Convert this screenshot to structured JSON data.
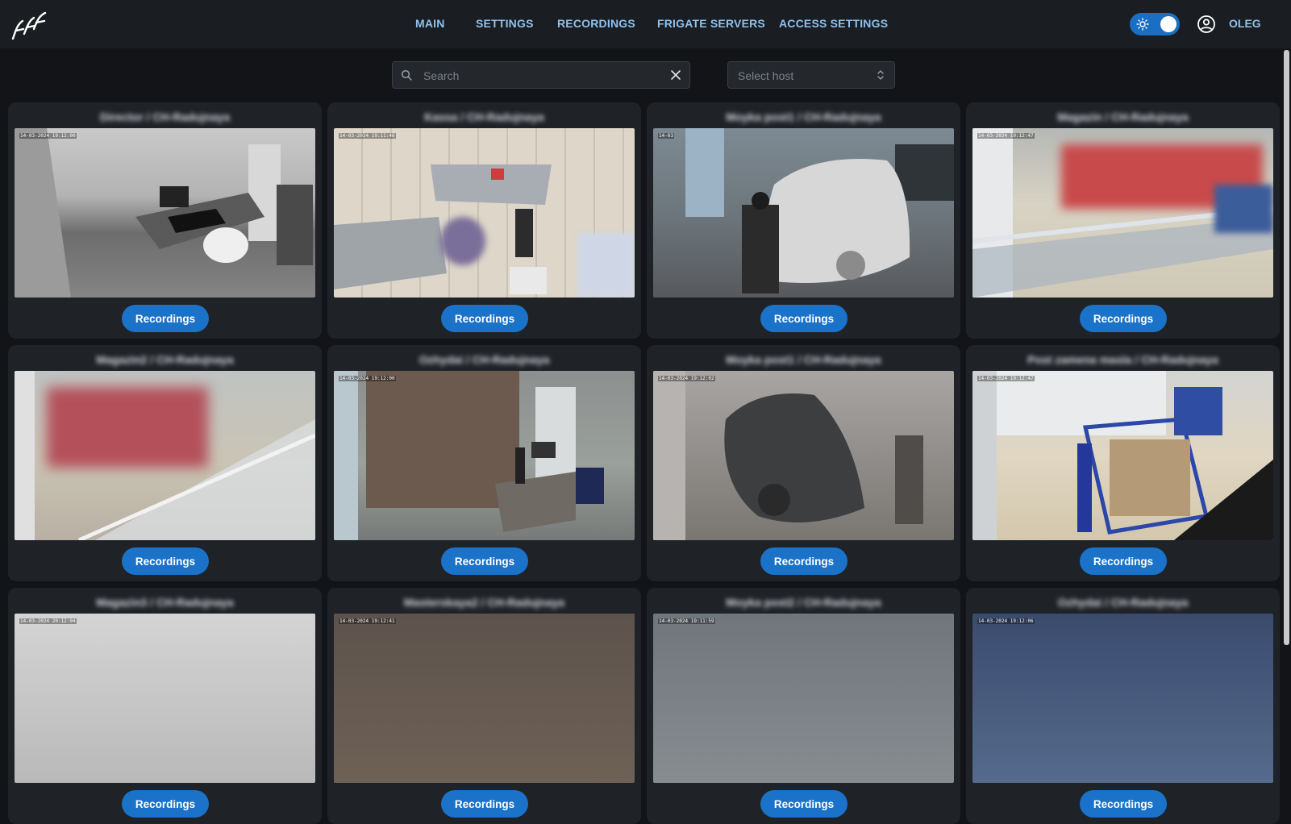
{
  "header": {
    "nav": [
      "MAIN",
      "SETTINGS",
      "RECORDINGS",
      "FRIGATE SERVERS",
      "ACCESS SETTINGS"
    ],
    "user_name": "OLEG",
    "theme_toggle": "light-mode-on",
    "logo_icon": "birds-logo-icon"
  },
  "filters": {
    "search_placeholder": "Search",
    "host_placeholder": "Select host"
  },
  "colors": {
    "accent": "#1a72c9",
    "nav_text": "#8fc1ee",
    "background": "#121417",
    "card": "#1f2227"
  },
  "cameras": [
    {
      "name": "Director / CH-Radujnaya",
      "timestamp": "14-03-2024 19:12:00",
      "button": "Recordings"
    },
    {
      "name": "Kassa / CH-Radujnaya",
      "timestamp": "14-03-2024 19:11:46",
      "button": "Recordings"
    },
    {
      "name": "Moyka post1 / CH-Radujnaya",
      "timestamp": "14-03",
      "button": "Recordings"
    },
    {
      "name": "Magazin / CH-Radujnaya",
      "timestamp": "14-03-2024 19:12:47",
      "button": "Recordings"
    },
    {
      "name": "Magazin2 / CH-Radujnaya",
      "timestamp": "",
      "button": "Recordings"
    },
    {
      "name": "Ozhydai / CH-Radujnaya",
      "timestamp": "14-03-2024 19:12:00",
      "button": "Recordings"
    },
    {
      "name": "Moyka post1 / CH-Radujnaya",
      "timestamp": "14-03-2024 19:12:02",
      "button": "Recordings"
    },
    {
      "name": "Post zamena masla / CH-Radujnaya",
      "timestamp": "14-03-2024 19:12:47",
      "button": "Recordings"
    },
    {
      "name": "Magazin3 / CH-Radujnaya",
      "timestamp": "14-03-2024 20:12:04",
      "button": "Recordings"
    },
    {
      "name": "Masterskaya2 / CH-Radujnaya",
      "timestamp": "14-03-2024 19:12:41",
      "button": "Recordings"
    },
    {
      "name": "Moyka post2 / CH-Radujnaya",
      "timestamp": "14-03-2024 19:11:59",
      "button": "Recordings"
    },
    {
      "name": "Ozhydai / CH-Radujnaya",
      "timestamp": "14-03-2024 19:12:06",
      "button": "Recordings"
    }
  ]
}
